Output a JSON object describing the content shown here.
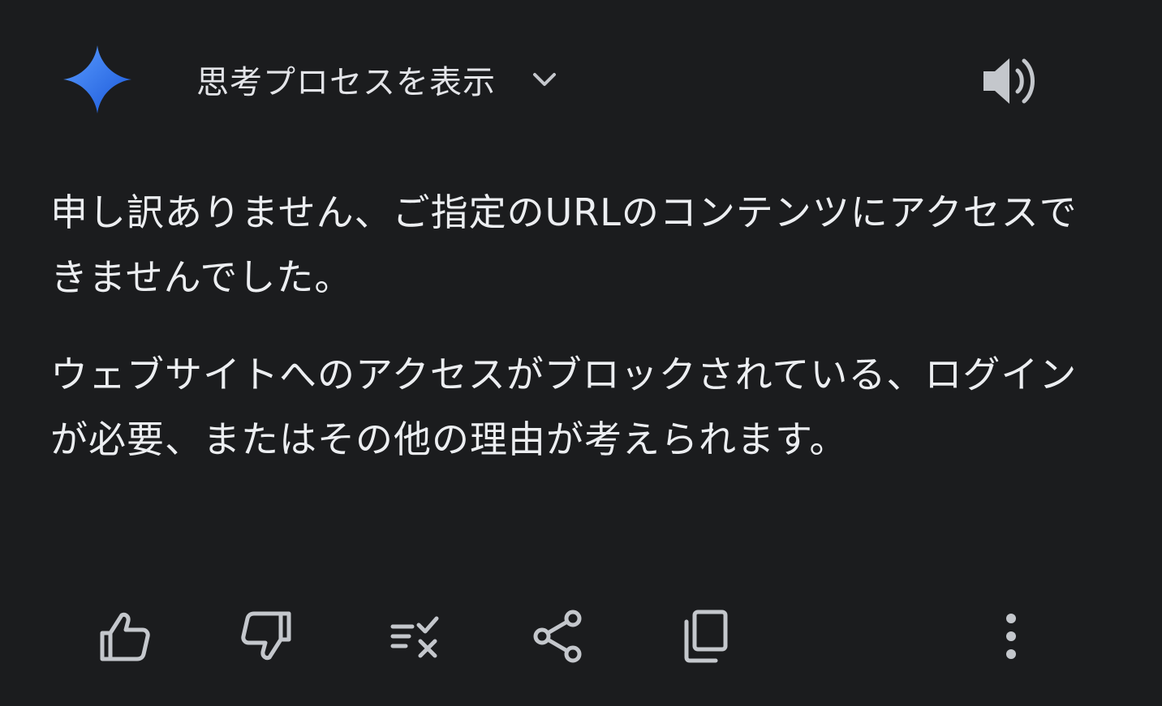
{
  "header": {
    "logo_icon": "gemini-sparkle-icon",
    "thinking_label": "思考プロセスを表示",
    "chevron_icon": "chevron-down-icon",
    "speaker_icon": "speaker-icon"
  },
  "message": {
    "paragraphs": [
      "申し訳ありません、ご指定のURLのコンテンツにアクセスできませんでした。",
      "ウェブサイトへのアクセスがブロックされている、ログインが必要、またはその他の理由が考えられます。"
    ]
  },
  "actions": {
    "items": [
      {
        "name": "thumbs-up-icon"
      },
      {
        "name": "thumbs-down-icon"
      },
      {
        "name": "modify-response-icon"
      },
      {
        "name": "share-icon"
      },
      {
        "name": "copy-icon"
      },
      {
        "name": "more-options-icon"
      }
    ]
  },
  "colors": {
    "background": "#1b1c1e",
    "text": "#eceef1",
    "icon": "#c4c7cc",
    "sparkle_start": "#4a8cf7",
    "sparkle_end": "#1f5fe0"
  }
}
